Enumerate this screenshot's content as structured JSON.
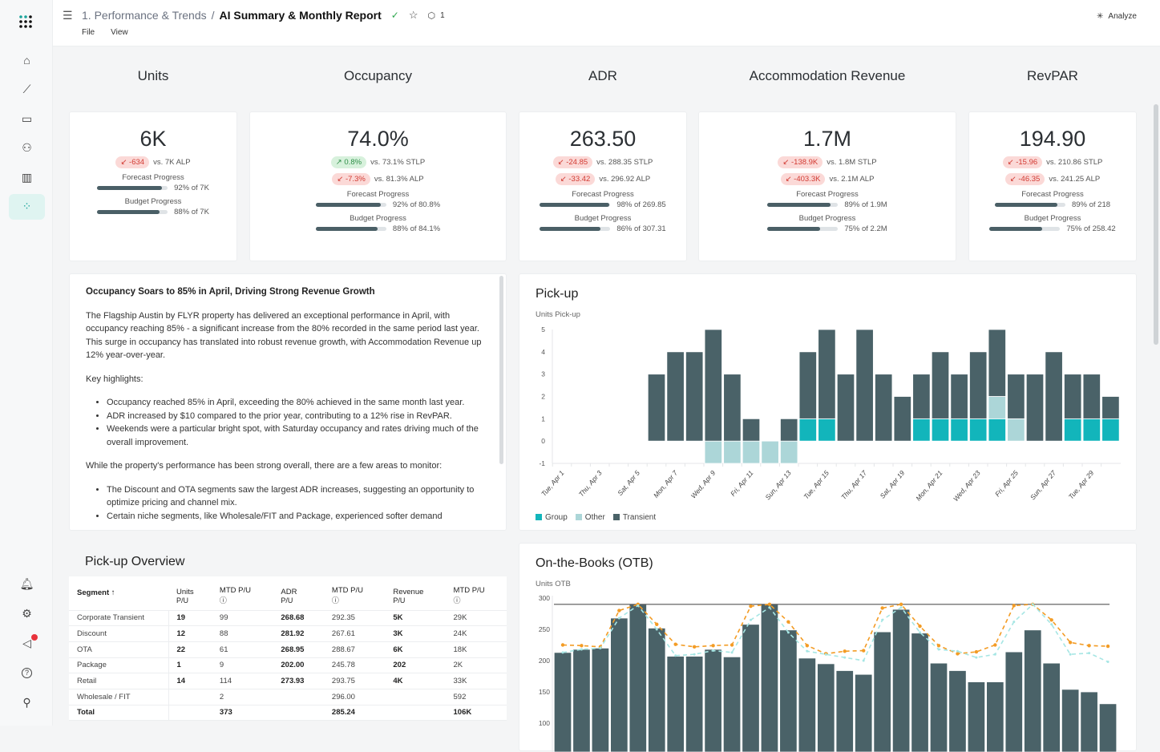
{
  "header": {
    "breadcrumb_parent": "1. Performance & Trends",
    "separator": "/",
    "title": "AI Summary & Monthly Report",
    "tag_count": "1",
    "menu": [
      "File",
      "View"
    ],
    "analyze_label": "Analyze"
  },
  "sidebar": {
    "top": [
      "home-icon",
      "trend-icon",
      "calendar-icon",
      "users-icon",
      "bar-chart-icon",
      "scatter-chart-icon"
    ],
    "bottom": [
      "bell-icon",
      "gear-icon",
      "megaphone-icon",
      "help-icon",
      "user-icon"
    ],
    "active": "scatter-chart-icon",
    "accent": "#1aa39a"
  },
  "kpis": [
    {
      "title": "Units",
      "value": "6K",
      "comparisons": [
        {
          "delta": "-634",
          "dir": "down",
          "text": "vs. 7K ALP"
        }
      ],
      "forecast": {
        "label": "Forecast Progress",
        "pct": 92,
        "text": "92% of 7K"
      },
      "budget": {
        "label": "Budget Progress",
        "pct": 88,
        "text": "88% of 7K"
      }
    },
    {
      "title": "Occupancy",
      "value": "74.0%",
      "comparisons": [
        {
          "delta": "0.8%",
          "dir": "up",
          "text": "vs. 73.1% STLP"
        },
        {
          "delta": "-7.3%",
          "dir": "down",
          "text": "vs. 81.3% ALP"
        }
      ],
      "forecast": {
        "label": "Forecast Progress",
        "pct": 92,
        "text": "92% of 80.8%"
      },
      "budget": {
        "label": "Budget Progress",
        "pct": 88,
        "text": "88% of 84.1%"
      }
    },
    {
      "title": "ADR",
      "value": "263.50",
      "comparisons": [
        {
          "delta": "-24.85",
          "dir": "down",
          "text": "vs. 288.35 STLP"
        },
        {
          "delta": "-33.42",
          "dir": "down",
          "text": "vs. 296.92 ALP"
        }
      ],
      "forecast": {
        "label": "Forecast Progress",
        "pct": 98,
        "text": "98% of 269.85"
      },
      "budget": {
        "label": "Budget Progress",
        "pct": 86,
        "text": "86% of 307.31"
      }
    },
    {
      "title": "Accommodation Revenue",
      "value": "1.7M",
      "comparisons": [
        {
          "delta": "-138.9K",
          "dir": "down",
          "text": "vs. 1.8M STLP"
        },
        {
          "delta": "-403.3K",
          "dir": "down",
          "text": "vs. 2.1M ALP"
        }
      ],
      "forecast": {
        "label": "Forecast Progress",
        "pct": 89,
        "text": "89% of 1.9M"
      },
      "budget": {
        "label": "Budget Progress",
        "pct": 75,
        "text": "75% of 2.2M"
      }
    },
    {
      "title": "RevPAR",
      "value": "194.90",
      "comparisons": [
        {
          "delta": "-15.96",
          "dir": "down",
          "text": "vs. 210.86 STLP"
        },
        {
          "delta": "-46.35",
          "dir": "down",
          "text": "vs. 241.25 ALP"
        }
      ],
      "forecast": {
        "label": "Forecast Progress",
        "pct": 89,
        "text": "89% of 218"
      },
      "budget": {
        "label": "Budget Progress",
        "pct": 75,
        "text": "75% of 258.42"
      }
    }
  ],
  "summary": {
    "heading": "Occupancy Soars to 85% in April, Driving Strong Revenue Growth",
    "p1": "The Flagship Austin by FLYR property has delivered an exceptional performance in April, with occupancy reaching 85% - a significant increase from the 80% recorded in the same period last year. This surge in occupancy has translated into robust revenue growth, with Accommodation Revenue up 12% year-over-year.",
    "p2": "Key highlights:",
    "list1": [
      "Occupancy reached 85% in April, exceeding the 80% achieved in the same month last year.",
      "ADR increased by $10 compared to the prior year, contributing to a 12% rise in RevPAR.",
      "Weekends were a particular bright spot, with Saturday occupancy and rates driving much of the overall improvement."
    ],
    "p3": "While the property's performance has been strong overall, there are a few areas to monitor:",
    "list2": [
      "The Discount and OTA segments saw the largest ADR increases, suggesting an opportunity to optimize pricing and channel mix.",
      "Certain niche segments, like Wholesale/FIT and Package, experienced softer demand"
    ]
  },
  "pickup_overview": {
    "title": "Pick-up Overview",
    "columns": [
      [
        "Segment ↑",
        ""
      ],
      [
        "Units",
        "P/U"
      ],
      [
        "MTD P/U",
        "ⓘ"
      ],
      [
        "ADR",
        "P/U"
      ],
      [
        "MTD P/U",
        "ⓘ"
      ],
      [
        "Revenue",
        "P/U"
      ],
      [
        "MTD P/U",
        "ⓘ"
      ]
    ],
    "rows": [
      [
        "Corporate Transient",
        "19",
        "99",
        "268.68",
        "292.35",
        "5K",
        "29K"
      ],
      [
        "Discount",
        "12",
        "88",
        "281.92",
        "267.61",
        "3K",
        "24K"
      ],
      [
        "OTA",
        "22",
        "61",
        "268.95",
        "288.67",
        "6K",
        "18K"
      ],
      [
        "Package",
        "1",
        "9",
        "202.00",
        "245.78",
        "202",
        "2K"
      ],
      [
        "Retail",
        "14",
        "114",
        "273.93",
        "293.75",
        "4K",
        "33K"
      ],
      [
        "Wholesale / FIT",
        "",
        "2",
        "",
        "296.00",
        "",
        "592"
      ],
      [
        "Total",
        "",
        "373",
        "",
        "285.24",
        "",
        "106K"
      ]
    ]
  },
  "chart_data": [
    {
      "type": "bar",
      "stacked": true,
      "title": "Pick-up",
      "ylabel": "Units Pick-up",
      "ylim": [
        -1,
        5
      ],
      "yticks": [
        -1,
        0,
        1,
        2,
        3,
        4,
        5
      ],
      "categories": [
        "Tue, Apr 1",
        "Wed, Apr 2",
        "Thu, Apr 3",
        "Fri, Apr 4",
        "Sat, Apr 5",
        "Sun, Apr 6",
        "Mon, Apr 7",
        "Tue, Apr 8",
        "Wed, Apr 9",
        "Thu, Apr 10",
        "Fri, Apr 11",
        "Sat, Apr 12",
        "Sun, Apr 13",
        "Mon, Apr 14",
        "Tue, Apr 15",
        "Wed, Apr 16",
        "Thu, Apr 17",
        "Fri, Apr 18",
        "Sat, Apr 19",
        "Sun, Apr 20",
        "Mon, Apr 21",
        "Tue, Apr 22",
        "Wed, Apr 23",
        "Thu, Apr 24",
        "Fri, Apr 25",
        "Sat, Apr 26",
        "Sun, Apr 27",
        "Mon, Apr 28",
        "Tue, Apr 29",
        "Wed, Apr 30"
      ],
      "tick_labels": [
        "Tue, Apr 1",
        "Thu, Apr 3",
        "Sat, Apr 5",
        "Mon, Apr 7",
        "Wed, Apr 9",
        "Fri, Apr 11",
        "Sun, Apr 13",
        "Tue, Apr 15",
        "Thu, Apr 17",
        "Sat, Apr 19",
        "Mon, Apr 21",
        "Wed, Apr 23",
        "Fri, Apr 25",
        "Sun, Apr 27",
        "Tue, Apr 29"
      ],
      "legend": "bottom-left",
      "series": [
        {
          "name": "Group",
          "color": "#12b5bb",
          "values": [
            0,
            0,
            0,
            0,
            0,
            0,
            0,
            0,
            0,
            0,
            0,
            0,
            0,
            1,
            1,
            0,
            0,
            0,
            0,
            1,
            1,
            1,
            1,
            1,
            0,
            0,
            0,
            1,
            1,
            1
          ]
        },
        {
          "name": "Other",
          "color": "#acd6d8",
          "values": [
            0,
            0,
            0,
            0,
            0,
            0,
            0,
            0,
            -1,
            -1,
            -1,
            -1,
            -1,
            0,
            0,
            0,
            0,
            0,
            0,
            0,
            0,
            0,
            0,
            1,
            1,
            0,
            0,
            0,
            0,
            0
          ]
        },
        {
          "name": "Transient",
          "color": "#4a6268",
          "values": [
            0,
            0,
            0,
            0,
            0,
            3,
            4,
            4,
            5,
            3,
            1,
            0,
            1,
            3,
            4,
            3,
            5,
            3,
            2,
            2,
            3,
            2,
            3,
            3,
            2,
            3,
            4,
            2,
            2,
            1
          ]
        }
      ]
    },
    {
      "type": "bar",
      "title": "On-the-Books (OTB)",
      "ylabel": "Units OTB",
      "ylim": [
        100,
        300
      ],
      "yticks": [
        100,
        150,
        200,
        250,
        300
      ],
      "bars": [
        213,
        218,
        220,
        268,
        290,
        252,
        207,
        207,
        218,
        206,
        258,
        290,
        249,
        204,
        195,
        184,
        178,
        246,
        282,
        244,
        196,
        184,
        166,
        166,
        214,
        249,
        196,
        154,
        150,
        131
      ],
      "capacity": 290,
      "lines": [
        {
          "color": "#f39c25",
          "values": [
            225,
            224,
            222,
            280,
            290,
            258,
            226,
            222,
            224,
            225,
            287,
            290,
            262,
            224,
            211,
            215,
            216,
            284,
            290,
            255,
            224,
            211,
            214,
            225,
            288,
            290,
            265,
            229,
            224,
            223
          ]
        },
        {
          "color": "#a6e6e4",
          "values": [
            213,
            218,
            220,
            268,
            288,
            250,
            208,
            210,
            216,
            213,
            265,
            285,
            245,
            215,
            210,
            205,
            200,
            265,
            285,
            245,
            218,
            215,
            205,
            210,
            262,
            290,
            258,
            210,
            212,
            198
          ]
        }
      ],
      "bar_color": "#4a6268"
    }
  ]
}
